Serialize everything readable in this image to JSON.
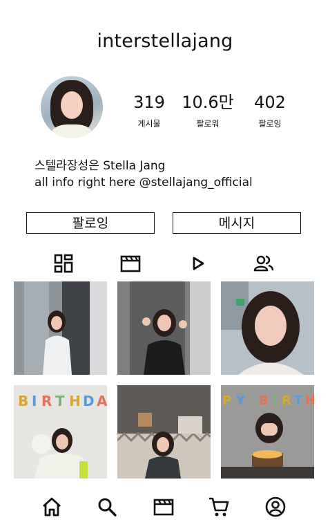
{
  "profile": {
    "username": "interstellajang",
    "stats": [
      {
        "value": "319",
        "label": "게시물"
      },
      {
        "value": "10.6만",
        "label": "팔로워"
      },
      {
        "value": "402",
        "label": "팔로잉"
      }
    ],
    "bio_line1": "스텔라장성은 Stella Jang",
    "bio_line2": "all info right here @stellajang_official"
  },
  "actions": {
    "follow_label": "팔로잉",
    "message_label": "메시지"
  },
  "content_tabs": [
    {
      "icon": "grid-icon"
    },
    {
      "icon": "reels-icon"
    },
    {
      "icon": "play-icon"
    },
    {
      "icon": "tagged-people-icon"
    }
  ],
  "posts": [
    {
      "description": "photo"
    },
    {
      "description": "photo"
    },
    {
      "description": "photo"
    },
    {
      "description": "birthday photo"
    },
    {
      "description": "birthday photo"
    },
    {
      "description": "birthday photo"
    }
  ],
  "bottom_nav": [
    {
      "icon": "home-icon"
    },
    {
      "icon": "search-icon"
    },
    {
      "icon": "reels-icon"
    },
    {
      "icon": "cart-icon"
    },
    {
      "icon": "profile-icon"
    }
  ]
}
